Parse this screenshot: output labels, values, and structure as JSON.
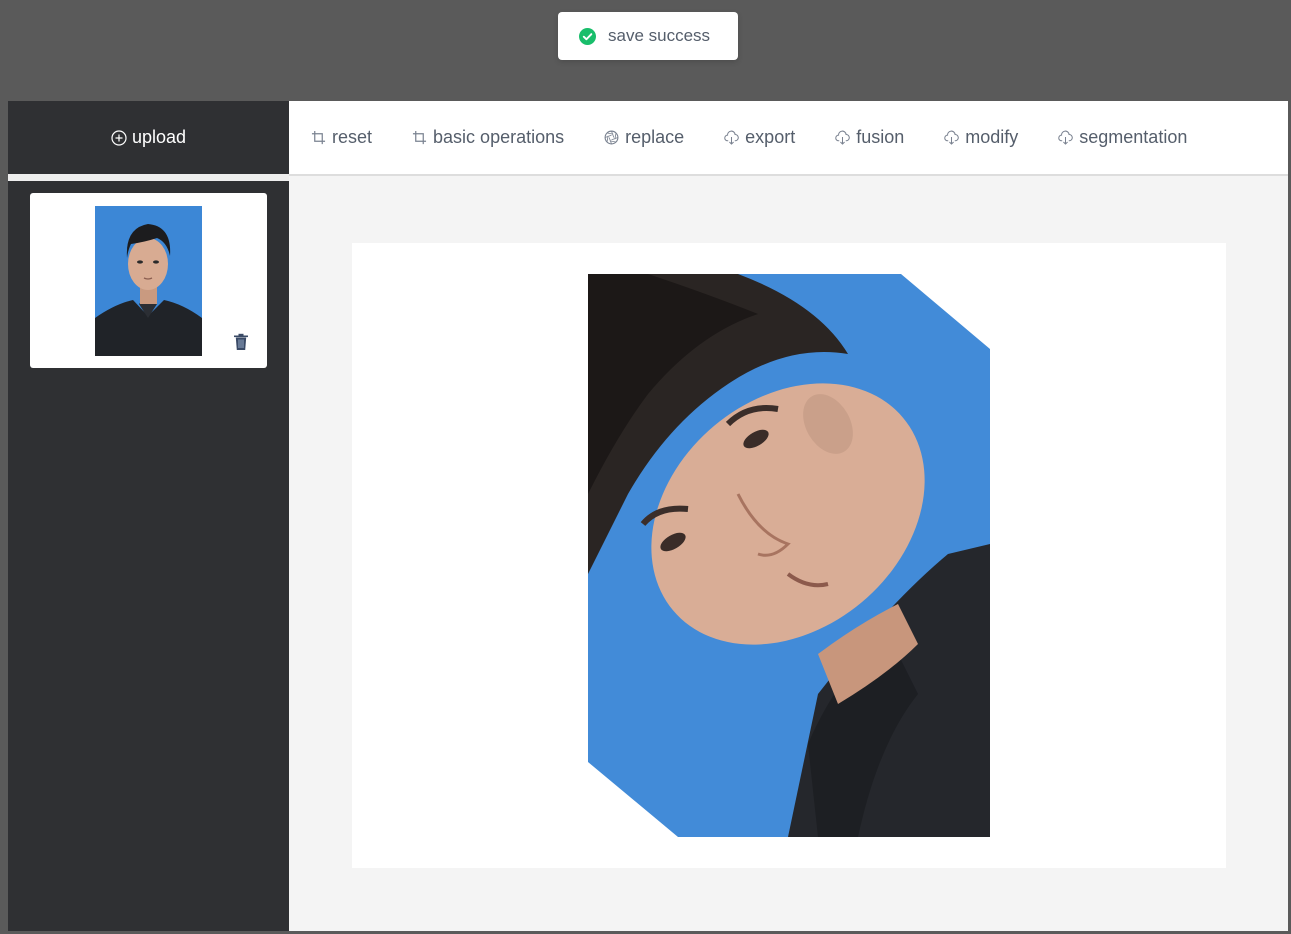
{
  "toast": {
    "message": "save success",
    "icon": "check-circle-icon",
    "icon_color": "#19be6b"
  },
  "sidebar": {
    "upload_label": "upload",
    "upload_icon": "plus-circle-icon",
    "thumbnails": [
      {
        "alt": "ID photo thumbnail",
        "delete_icon": "trash-icon"
      }
    ]
  },
  "toolbar": {
    "items": [
      {
        "label": "reset",
        "icon": "crop-icon"
      },
      {
        "label": "basic operations",
        "icon": "crop-icon"
      },
      {
        "label": "replace",
        "icon": "aperture-icon"
      },
      {
        "label": "export",
        "icon": "cloud-download-icon"
      },
      {
        "label": "fusion",
        "icon": "cloud-download-icon"
      },
      {
        "label": "modify",
        "icon": "cloud-download-icon"
      },
      {
        "label": "segmentation",
        "icon": "cloud-download-icon"
      }
    ]
  },
  "colors": {
    "overlay": "#5a5a5a",
    "sidebar": "#2f3033",
    "photo_background": "#3c87d6",
    "text": "#555e6b"
  }
}
